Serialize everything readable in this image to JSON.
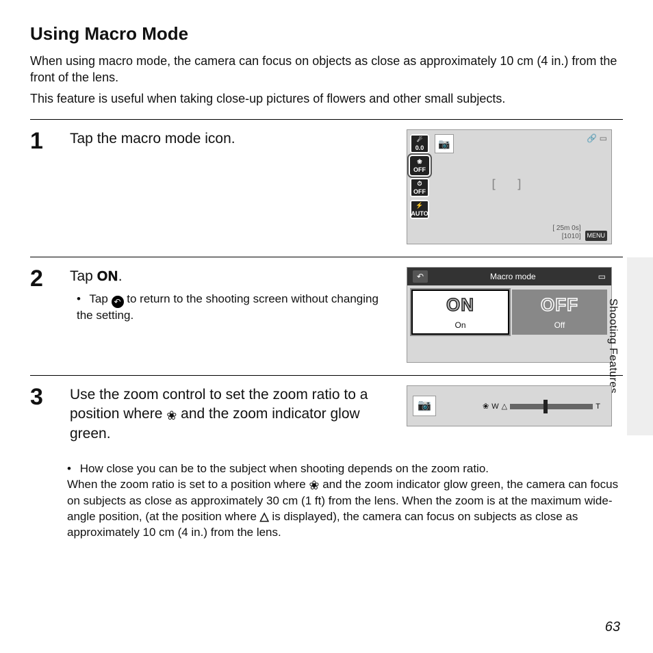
{
  "title": "Using Macro Mode",
  "intro": [
    "When using macro mode, the camera can focus on objects as close as approximately 10 cm (4 in.) from the front of the lens.",
    "This feature is useful when taking close-up pictures of flowers and other small subjects."
  ],
  "side_label": "Shooting Features",
  "page_number": "63",
  "steps": {
    "s1": {
      "num": "1",
      "lead": "Tap the macro mode icon.",
      "lcd": {
        "left_icons": [
          {
            "main": "☄",
            "sub": "0.0"
          },
          {
            "main": "❀",
            "sub": "OFF"
          },
          {
            "main": "⏱",
            "sub": "OFF"
          },
          {
            "main": "⚡",
            "sub": "AUTO"
          }
        ],
        "top_icon": "📷",
        "tr_icon": "🔗 ▭",
        "focus": "[   ]",
        "time": "[ 25m 0s]",
        "counter": "[1010]",
        "menu": "MENU"
      }
    },
    "s2": {
      "num": "2",
      "lead_pre": "Tap ",
      "lead_on": "ON",
      "lead_post": ".",
      "bullet_pre": "Tap ",
      "bullet_icon": "↶",
      "bullet_post": " to return to the shooting screen without changing the setting.",
      "lcd": {
        "back": "↶",
        "title": "Macro mode",
        "batt": "▭",
        "on_big": "ON",
        "on_label": "On",
        "off_big": "OFF",
        "off_label": "Off"
      }
    },
    "s3": {
      "num": "3",
      "lead_a": "Use the zoom control to set the zoom ratio to a position where ",
      "lead_flower": "❀",
      "lead_b": " and the zoom indicator glow green.",
      "lcd": {
        "cam": "📷",
        "w": "W",
        "t": "T",
        "flower": "❀",
        "tri": "△"
      },
      "follow_a": "How close you can be to the subject when shooting depends on the zoom ratio.",
      "follow_b1": "When the zoom ratio is set to a position where ",
      "follow_b2": " and the zoom indicator glow green, the camera can focus on subjects as close as approximately 30 cm (1 ft) from the lens. When the zoom is at the maximum wide-angle position, (at the position where ",
      "follow_b3": " is displayed), the camera can focus on subjects as close as approximately 10 cm (4 in.) from the lens."
    }
  }
}
